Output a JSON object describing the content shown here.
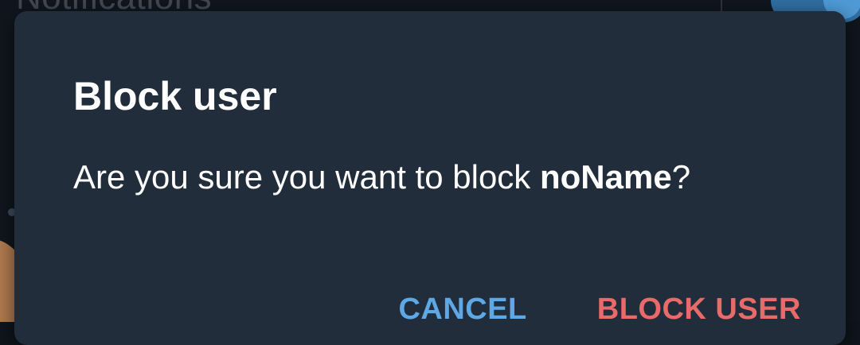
{
  "background": {
    "header_title": "Notifications",
    "toggle_accent": "#2f6fa3"
  },
  "dialog": {
    "title": "Block user",
    "message_prefix": "Are you sure you want to block ",
    "username": "noName",
    "message_suffix": "?",
    "cancel_label": "CANCEL",
    "confirm_label": "BLOCK USER"
  },
  "colors": {
    "dialog_bg": "#212d3b",
    "cancel": "#5fa8e6",
    "destructive": "#e86a6a",
    "text": "#ffffff"
  }
}
